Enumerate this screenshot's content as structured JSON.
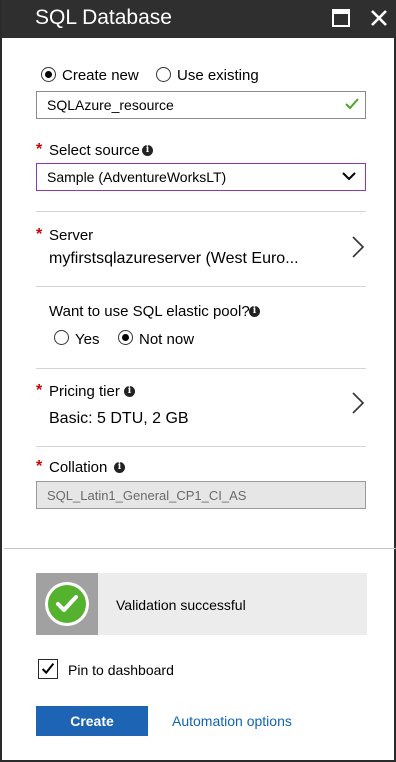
{
  "window": {
    "title": "SQL Database",
    "maximize_icon": "maximize-icon",
    "close_icon": "close-icon"
  },
  "resource_group": {
    "options": [
      {
        "label": "Create new",
        "selected": true
      },
      {
        "label": "Use existing",
        "selected": false
      }
    ],
    "value": "SQLAzure_resource",
    "valid_icon": "checkmark-icon"
  },
  "source": {
    "label": "Select source",
    "value": "Sample (AdventureWorksLT)"
  },
  "server": {
    "label": "Server",
    "value": "myfirstsqlazureserver (West Euro..."
  },
  "elastic_pool": {
    "label": "Want to use SQL elastic pool?",
    "options": [
      {
        "label": "Yes",
        "selected": false
      },
      {
        "label": "Not now",
        "selected": true
      }
    ]
  },
  "pricing": {
    "label": "Pricing tier",
    "value": "Basic: 5 DTU, 2 GB"
  },
  "collation": {
    "label": "Collation",
    "value": "SQL_Latin1_General_CP1_CI_AS"
  },
  "validation": {
    "text": "Validation successful",
    "status_color": "#55b22e"
  },
  "pin": {
    "label": "Pin to dashboard",
    "checked": true
  },
  "actions": {
    "create": "Create",
    "automation": "Automation options"
  },
  "colors": {
    "titlebar": "#2f2f2f",
    "required": "#d20000",
    "primary_button": "#1e64b4",
    "link": "#0f64b4",
    "select_border": "#8a3bb3"
  }
}
